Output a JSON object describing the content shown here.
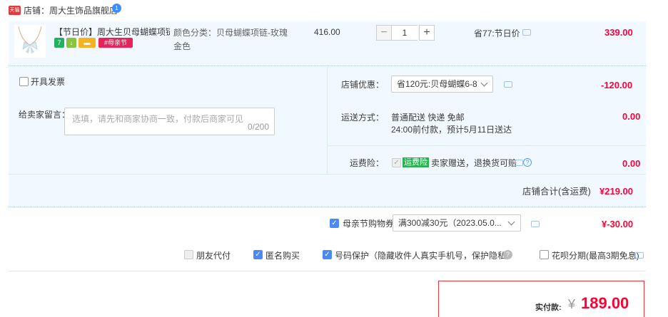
{
  "shop": {
    "logo_text": "天猫",
    "label": "店铺：",
    "name": "周大生饰品旗舰店",
    "badge": "1"
  },
  "item": {
    "title": "【节日价】周大生贝母蝴蝶项链...",
    "tags": [
      "7",
      "↓",
      "▬",
      "#母亲节"
    ],
    "sku_label": "颜色分类：",
    "sku_value": "贝母蝴蝶项链-玫瑰金色",
    "unit_price": "416.00",
    "quantity": "1",
    "minus": "−",
    "plus": "+",
    "save_text": "省77:节日价",
    "subtotal": "339.00"
  },
  "invoice": {
    "label": "开具发票"
  },
  "message": {
    "label": "给卖家留言：",
    "placeholder": "选填，请先和商家协商一致，付款后商家可见",
    "count": "0/200"
  },
  "shop_discount": {
    "label": "店铺优惠：",
    "selected": "省120元:贝母蝴蝶6-8",
    "amount": "-120.00"
  },
  "shipping": {
    "label": "运送方式：",
    "method": "普通配送 快递 免邮",
    "eta": "24:00前付款，预计5月11日送达",
    "amount": "0.00"
  },
  "insurance": {
    "label": "运费险：",
    "badge": "运费险",
    "desc": "卖家赠送，退换货可赔",
    "help": "?",
    "amount": "0.00"
  },
  "shop_total": {
    "label": "店铺合计(含运费)",
    "amount": "¥219.00"
  },
  "coupon": {
    "label": "母亲节购物券",
    "selected": "满300减30元（2023.05.0...",
    "amount": "¥-30.00"
  },
  "options": {
    "friend_pay": "朋友代付",
    "anonymous": "匿名购买",
    "privacy": "号码保护（隐藏收件人真实手机号，保护隐私）",
    "privacy_help": "?",
    "huabei": "花呗分期(最高3期免息)"
  },
  "payment": {
    "label": "实付款:",
    "currency": "¥",
    "amount": "189.00"
  },
  "colors": {
    "accent_red": "#ff0036",
    "row_bg": "#f2f8ff",
    "checkbox_blue": "#4a8af4"
  }
}
